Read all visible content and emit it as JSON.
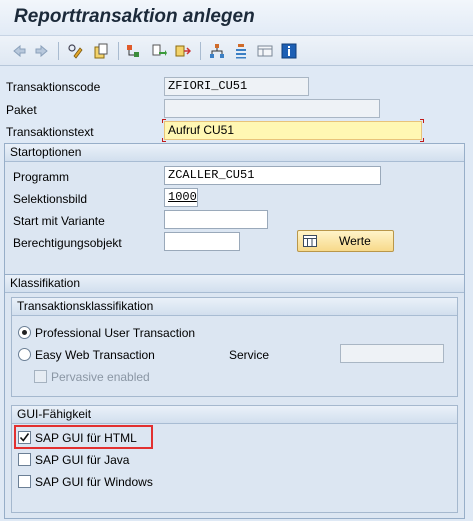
{
  "title": "Reporttransaktion anlegen",
  "toolbar": {
    "icons": [
      "back-arrow-icon",
      "forward-arrow-icon",
      "display-change-icon",
      "copy-object-icon",
      "hierarchy-icon",
      "transport-icon",
      "move-icon",
      "tree-structure-icon",
      "tree-expand-icon",
      "layout-icon",
      "info-icon"
    ]
  },
  "header_fields": {
    "tcode_label": "Transaktionscode",
    "tcode_value": "ZFIORI_CU51",
    "package_label": "Paket",
    "package_value": "",
    "text_label": "Transaktionstext",
    "text_value": "Aufruf CU51"
  },
  "start_options": {
    "title": "Startoptionen",
    "program_label": "Programm",
    "program_value": "ZCALLER_CU51",
    "screen_label": "Selektionsbild",
    "screen_value": "1000",
    "variant_label": "Start mit Variante",
    "variant_value": "",
    "auth_label": "Berechtigungsobjekt",
    "auth_value": "",
    "values_button": "Werte"
  },
  "classification": {
    "title": "Klassifikation",
    "tx_class": {
      "title": "Transaktionsklassifikation",
      "option_professional": "Professional User Transaction",
      "option_easyweb": "Easy Web Transaction",
      "service_label": "Service",
      "service_value": "",
      "pervasive_label": "Pervasive enabled",
      "selected": "professional"
    },
    "gui": {
      "title": "GUI-Fähigkeit",
      "html_label": "SAP GUI für HTML",
      "java_label": "SAP GUI für Java",
      "windows_label": "SAP GUI für Windows",
      "html_checked": true,
      "java_checked": false,
      "windows_checked": false
    }
  },
  "colors": {
    "background": "#dfe9f5",
    "required_field": "#fff7b3",
    "highlight": "#e23030",
    "button": "#f7d98a"
  }
}
